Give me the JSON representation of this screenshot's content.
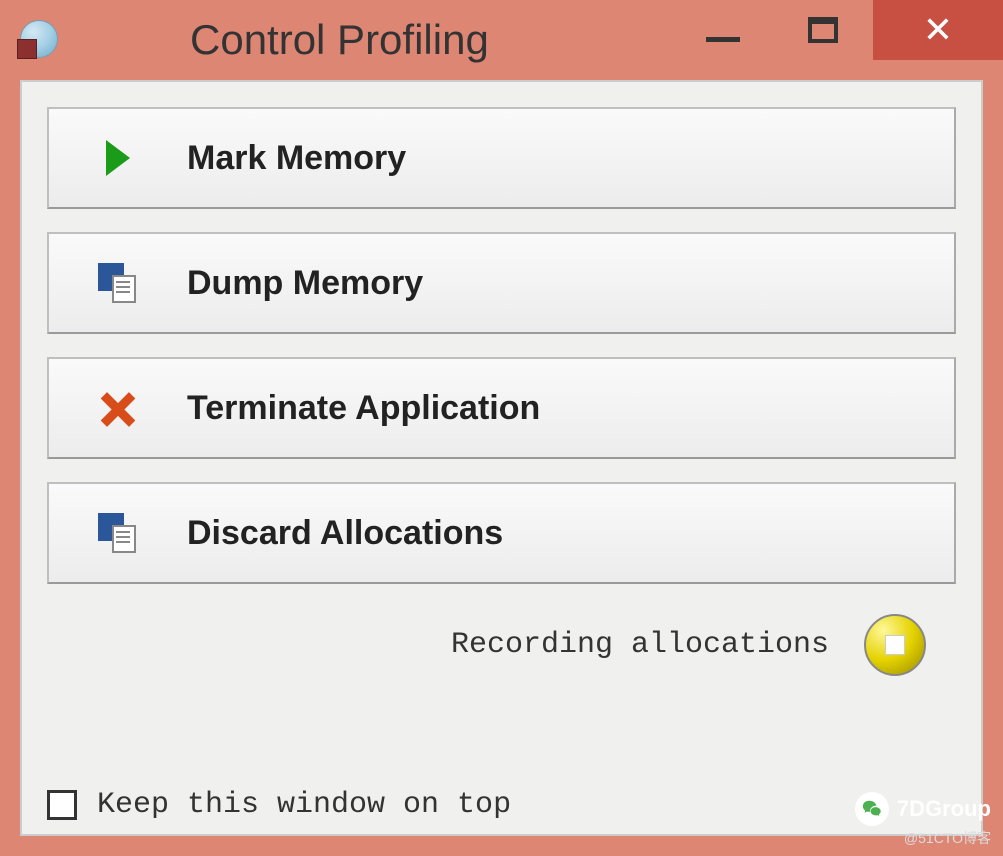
{
  "titlebar": {
    "title": "Control Profiling"
  },
  "actions": [
    {
      "label": "Mark Memory",
      "icon": "play"
    },
    {
      "label": "Dump Memory",
      "icon": "docs"
    },
    {
      "label": "Terminate Application",
      "icon": "x"
    },
    {
      "label": "Discard Allocations",
      "icon": "docs"
    }
  ],
  "status": {
    "text": "Recording allocations"
  },
  "footer": {
    "checkbox_label": "Keep this window on top",
    "checked": false
  },
  "watermark": {
    "main": "7DGroup",
    "sub": "@51CTO博客"
  }
}
